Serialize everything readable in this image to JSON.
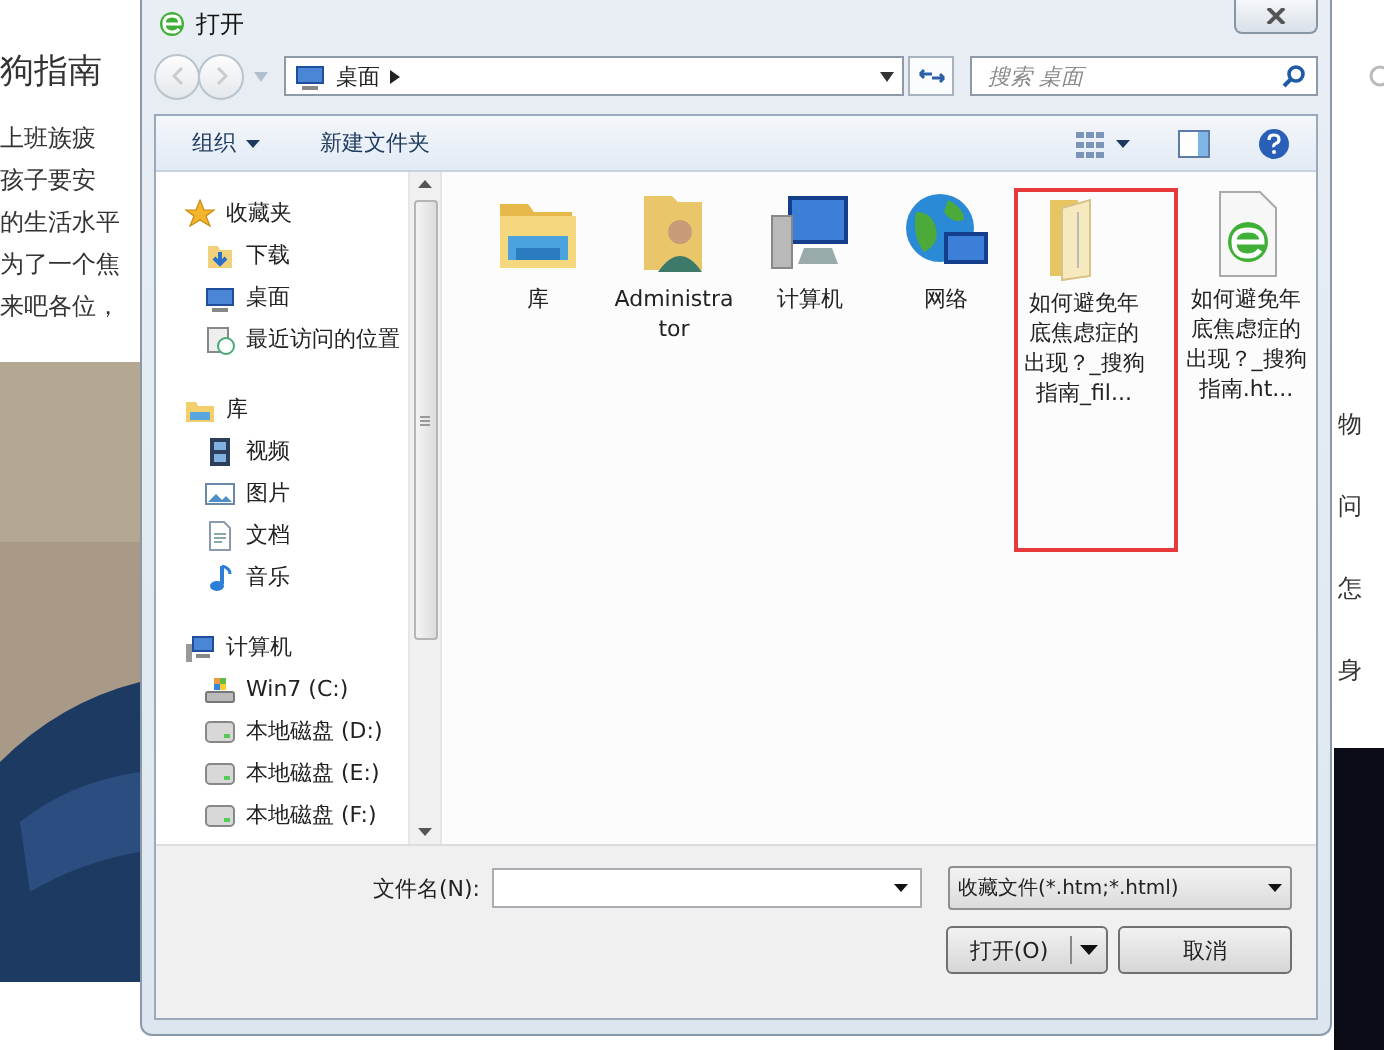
{
  "page": {
    "heading": "狗指南",
    "lines": [
      "上班族疲",
      "孩子要安",
      "的生活水平",
      "为了一个焦",
      "来吧各位，"
    ],
    "side_items": [
      "物",
      "问",
      "怎",
      "身"
    ],
    "photo": {
      "kind": "picture"
    }
  },
  "dialog": {
    "title": "打开",
    "address": {
      "location": "桌面"
    },
    "search": {
      "placeholder": "搜索 桌面"
    },
    "toolbar": {
      "organize": "组织",
      "new_folder": "新建文件夹"
    },
    "sidebar": [
      {
        "label": "收藏夹",
        "kind": "star",
        "children": [
          {
            "label": "下载",
            "kind": "download"
          },
          {
            "label": "桌面",
            "kind": "desktop"
          },
          {
            "label": "最近访问的位置",
            "kind": "recent"
          }
        ]
      },
      {
        "label": "库",
        "kind": "library",
        "children": [
          {
            "label": "视频",
            "kind": "video"
          },
          {
            "label": "图片"
          },
          {
            "label": "文档",
            "kind": "document"
          },
          {
            "label": "音乐",
            "kind": "music"
          }
        ]
      },
      {
        "label": "计算机",
        "kind": "computer",
        "children": [
          {
            "label": "Win7 (C:)",
            "kind": "system-drive"
          },
          {
            "label": "本地磁盘 (D:)",
            "kind": "drive"
          },
          {
            "label": "本地磁盘 (E:)",
            "kind": "drive"
          },
          {
            "label": "本地磁盘 (F:)",
            "kind": "drive"
          }
        ]
      }
    ],
    "files": [
      {
        "name": "库",
        "kind": "library",
        "highlighted": false
      },
      {
        "name": "Administrator",
        "kind": "user",
        "highlighted": false
      },
      {
        "name": "计算机",
        "kind": "computer",
        "highlighted": false
      },
      {
        "name": "网络",
        "kind": "network",
        "highlighted": false
      },
      {
        "name": "如何避免年底焦虑症的出现？_搜狗指南_fil...",
        "kind": "folder",
        "highlighted": true
      },
      {
        "name": "如何避免年底焦虑症的出现？_搜狗指南.ht...",
        "kind": "html",
        "highlighted": false
      }
    ],
    "filename": {
      "label": "文件名(N):"
    },
    "filetype": "收藏文件(*.htm;*.html)",
    "buttons": {
      "open": "打开(O)",
      "cancel": "取消"
    }
  }
}
